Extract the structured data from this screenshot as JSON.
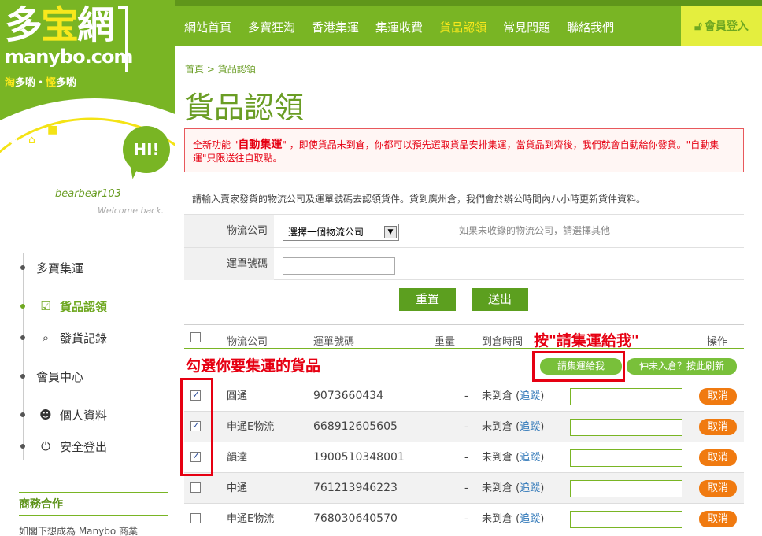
{
  "logo": {
    "cn_left": "多",
    "cn_mid": "宝",
    "cn_right": "網",
    "en": "manybo.com",
    "tag_a": "淘",
    "tag_b": "多喲・",
    "tag_c": "悭",
    "tag_d": "多喲"
  },
  "user": {
    "greeting": "HI!",
    "name": "bearbear103",
    "welcome": "Welcome back."
  },
  "sidebar": {
    "items": [
      {
        "label": "多寶集運",
        "icon": "",
        "group": true
      },
      {
        "label": "貨品認領",
        "icon": "checkbox-icon",
        "active": true
      },
      {
        "label": "發貨記錄",
        "icon": "search-icon"
      },
      {
        "label": "會員中心",
        "icon": "",
        "group": true
      },
      {
        "label": "個人資料",
        "icon": "user-icon"
      },
      {
        "label": "安全登出",
        "icon": "power-icon"
      }
    ],
    "biz_title": "商務合作",
    "biz_text": "如閣下想成為 Manybo 商業"
  },
  "topnav": {
    "items": [
      "網站首頁",
      "多寶狂淘",
      "香港集運",
      "集運收費",
      "貨品認領",
      "常見問題",
      "聯絡我們"
    ],
    "active_index": 4,
    "login": "會員登入"
  },
  "breadcrumb": {
    "home": "首頁",
    "sep": ">",
    "current": "貨品認領"
  },
  "page_title": "貨品認領",
  "notice": {
    "part1": "全新功能 \"",
    "bold": "自動集運",
    "part2": "\" ，即使貨品未到倉，你都可以預先選取貨品安排集運，當貨品到齊後，我們就會自動給你發貨。\"自動集運\"只限送往自取點。"
  },
  "intro": "請輸入賣家發貨的物流公司及運單號碼去認領貨件。貨到廣州倉，我們會於辦公時間內八小時更新貨件資料。",
  "form": {
    "courier_label": "物流公司",
    "courier_selected": "選擇一個物流公司",
    "courier_hint": "如果未收錄的物流公司，請選擇其他",
    "tracking_label": "運單號碼",
    "tracking_value": "",
    "reset": "重置",
    "submit": "送出"
  },
  "list": {
    "headers": {
      "courier": "物流公司",
      "tracking": "運單號碼",
      "weight": "重量",
      "arrival": "到倉時間",
      "actions": "操作"
    },
    "ship_button": "請集運給我",
    "refresh_button": "仲未入倉？按此刷新",
    "rows": [
      {
        "checked": true,
        "courier": "圓通",
        "tracking": "9073660434",
        "weight": "-",
        "status": "未到倉",
        "track": "追蹤",
        "cancel": "取消"
      },
      {
        "checked": true,
        "courier": "申通E物流",
        "tracking": "668912605605",
        "weight": "-",
        "status": "未到倉",
        "track": "追蹤",
        "cancel": "取消"
      },
      {
        "checked": true,
        "courier": "韻達",
        "tracking": "1900510348001",
        "weight": "-",
        "status": "未到倉",
        "track": "追蹤",
        "cancel": "取消"
      },
      {
        "checked": false,
        "courier": "中通",
        "tracking": "761213946223",
        "weight": "-",
        "status": "未到倉",
        "track": "追蹤",
        "cancel": "取消"
      },
      {
        "checked": false,
        "courier": "申通E物流",
        "tracking": "768030640570",
        "weight": "-",
        "status": "未到倉",
        "track": "追蹤",
        "cancel": "取消"
      }
    ]
  },
  "annotations": {
    "left": "勾選你要集運的貨品",
    "right": "按\"請集運給我\""
  },
  "colors": {
    "brand_green": "#79b524",
    "nav_active": "#f8e81c",
    "alert_red": "#e60012",
    "cancel_orange": "#f07a10"
  }
}
